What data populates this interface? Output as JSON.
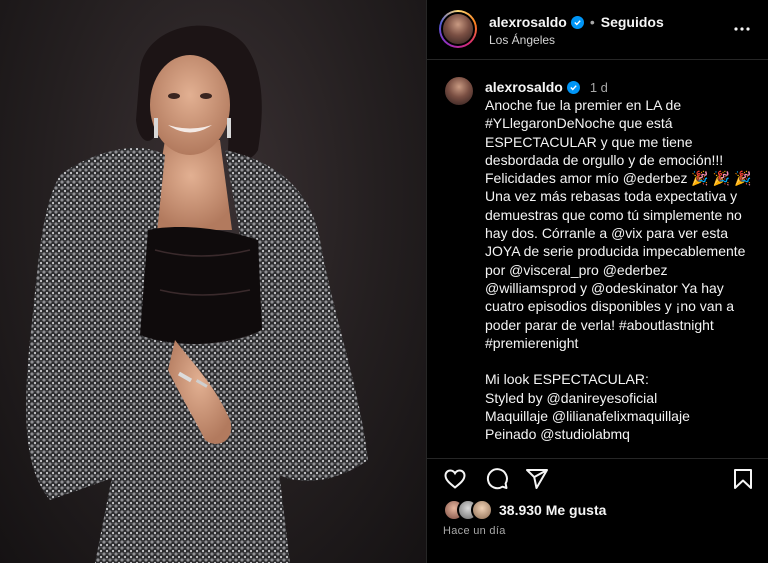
{
  "post": {
    "username": "alexrosaldo",
    "follow_status": "Seguidos",
    "location": "Los Ángeles",
    "dot": "•"
  },
  "caption": {
    "username": "alexrosaldo",
    "time": "1 d",
    "text": "Anoche fue la premier en LA de #YLlegaronDeNoche que está ESPECTACULAR y que me tiene desbordada de orgullo y de emoción!!! Felicidades amor mío @ederbez 🎉 🎉 🎉 Una vez más rebasas toda expectativa y demuestras que como tú simplemente no hay dos. Córranle a @vix para ver esta JOYA de serie producida impecablemente por @visceral_pro @ederbez @williamsprod y @odeskinator Ya hay cuatro episodios disponibles y ¡no van a poder parar de verla! #aboutlastnight #premierenight\n\nMi look ESPECTACULAR:\nStyled by @danireyesoficial\nMaquillaje @lilianafelixmaquillaje\nPeinado @studiolabmq"
  },
  "stats": {
    "likes_count": "38.930",
    "likes_label": "Me gusta",
    "time_ago": "Hace un día"
  },
  "icons": {
    "more": "more-horizontal-icon",
    "like": "heart-icon",
    "comment": "comment-icon",
    "share": "share-icon",
    "save": "bookmark-icon",
    "verified": "verified-badge-icon"
  },
  "colors": {
    "background": "#000000",
    "text": "#f5f5f5",
    "secondary_text": "#a8a8a8",
    "verified": "#0095f6",
    "divider": "#262626"
  }
}
